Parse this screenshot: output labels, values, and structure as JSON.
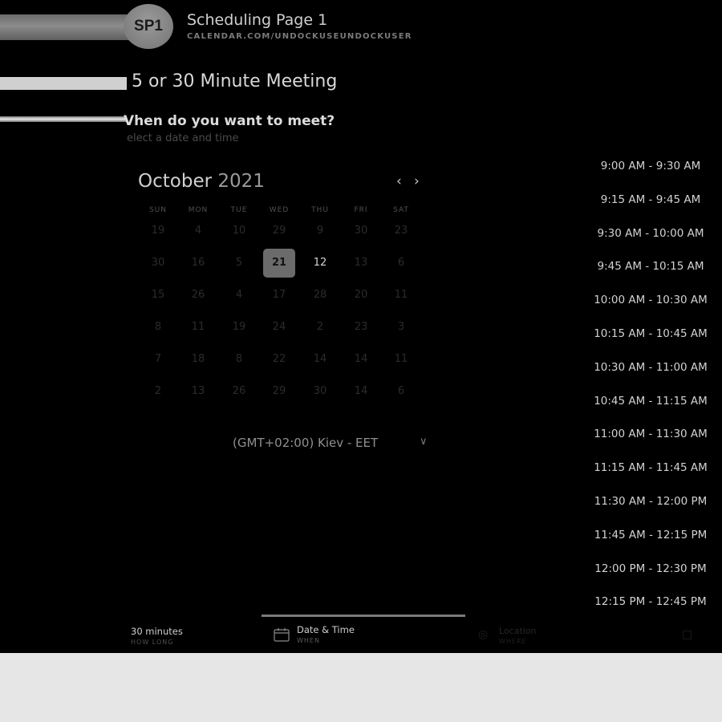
{
  "header": {
    "avatar_initials": "SP1",
    "page_title": "Scheduling Page 1",
    "page_url": "CALENDAR.COM/UNDOCKUSEUNDOCKUSER"
  },
  "meeting": {
    "title": "5 or 30 Minute Meeting",
    "question": "Vhen do you want to meet?",
    "hint": "elect a date and time"
  },
  "calendar": {
    "month": "October",
    "year": "2021",
    "weekdays": [
      "SUN",
      "MON",
      "TUE",
      "WED",
      "THU",
      "FRI",
      "SAT"
    ],
    "rows": [
      [
        {
          "d": "19"
        },
        {
          "d": "4"
        },
        {
          "d": "10"
        },
        {
          "d": "29"
        },
        {
          "d": "9"
        },
        {
          "d": "30"
        },
        {
          "d": "23"
        }
      ],
      [
        {
          "d": "30"
        },
        {
          "d": "16"
        },
        {
          "d": "5"
        },
        {
          "d": "21",
          "selected": true
        },
        {
          "d": "12",
          "available": true
        },
        {
          "d": "13"
        },
        {
          "d": "6"
        }
      ],
      [
        {
          "d": "15"
        },
        {
          "d": "26"
        },
        {
          "d": "4"
        },
        {
          "d": "17"
        },
        {
          "d": "28"
        },
        {
          "d": "20"
        },
        {
          "d": "11"
        }
      ],
      [
        {
          "d": "8"
        },
        {
          "d": "11"
        },
        {
          "d": "19"
        },
        {
          "d": "24"
        },
        {
          "d": "2"
        },
        {
          "d": "23"
        },
        {
          "d": "3"
        }
      ],
      [
        {
          "d": "7"
        },
        {
          "d": "18"
        },
        {
          "d": "8"
        },
        {
          "d": "22"
        },
        {
          "d": "14"
        },
        {
          "d": "14"
        },
        {
          "d": "11"
        }
      ],
      [
        {
          "d": "2"
        },
        {
          "d": "13"
        },
        {
          "d": "26"
        },
        {
          "d": "29"
        },
        {
          "d": "30"
        },
        {
          "d": "14"
        },
        {
          "d": "6"
        }
      ]
    ],
    "prev_icon": "chevron-left-icon",
    "next_icon": "chevron-right-icon"
  },
  "timezone": {
    "label": "(GMT+02:00) Kiev - EET",
    "chevron": "∨"
  },
  "time_slots": [
    "9:00 AM - 9:30 AM",
    "9:15 AM - 9:45 AM",
    "9:30 AM - 10:00 AM",
    "9:45 AM - 10:15 AM",
    "10:00 AM - 10:30 AM",
    "10:15 AM - 10:45 AM",
    "10:30 AM - 11:00 AM",
    "10:45 AM - 11:15 AM",
    "11:00 AM - 11:30 AM",
    "11:15 AM - 11:45 AM",
    "11:30 AM - 12:00 PM",
    "11:45 AM - 12:15 PM",
    "12:00 PM - 12:30 PM",
    "12:15 PM - 12:45 PM"
  ],
  "footer": {
    "duration": {
      "label": "30 minutes",
      "sub": "HOW LONG"
    },
    "datetime": {
      "label": "Date & Time",
      "sub": "WHEN",
      "icon": "calendar-icon"
    },
    "location": {
      "label": "Location",
      "sub": "WHERE",
      "icon": "location-icon"
    },
    "next": {
      "icon": "contact-icon"
    }
  },
  "colors": {
    "background": "#000000",
    "selected_day": "#6b6b6b",
    "outer": "#e6e6e6"
  }
}
